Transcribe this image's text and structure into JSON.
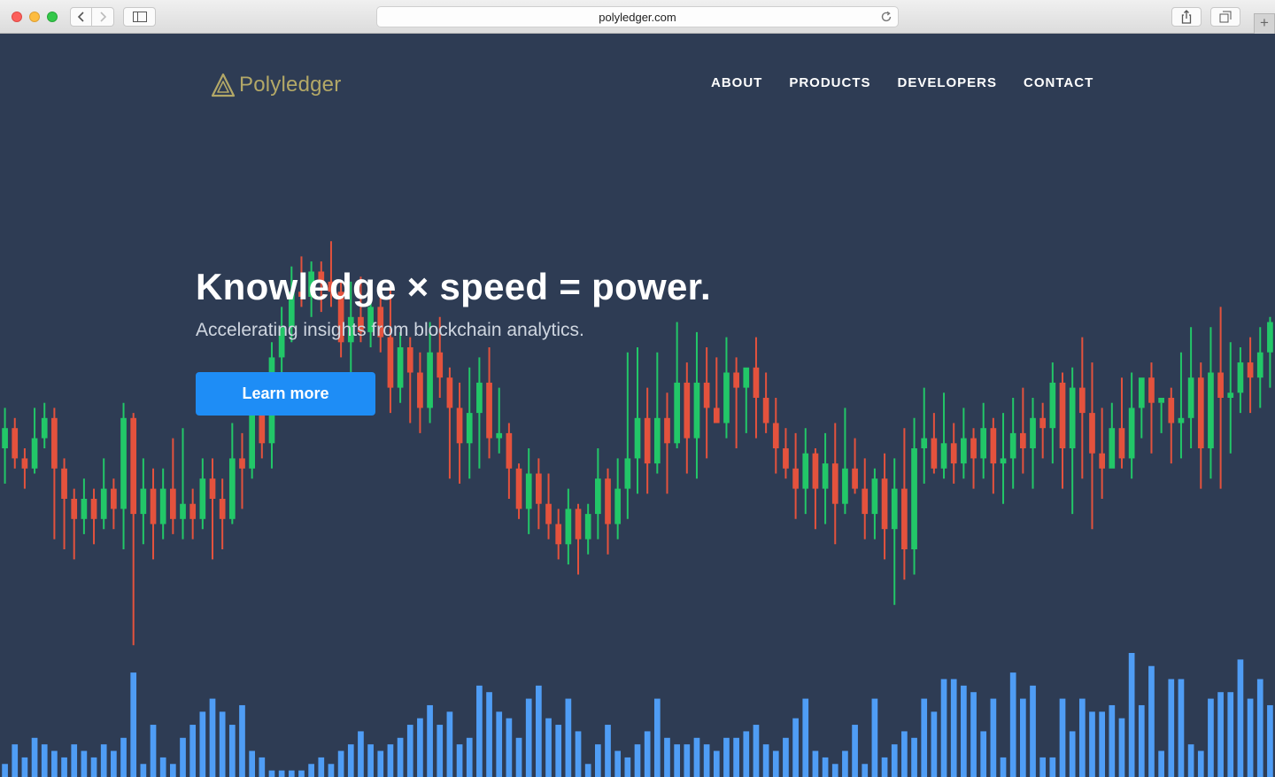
{
  "browser": {
    "url": "polyledger.com",
    "newtab_label": "+"
  },
  "brand": {
    "name": "Polyledger",
    "accent": "#b3a867"
  },
  "nav": [
    {
      "label": "ABOUT"
    },
    {
      "label": "PRODUCTS"
    },
    {
      "label": "DEVELOPERS"
    },
    {
      "label": "CONTACT"
    }
  ],
  "hero": {
    "title": "Knowledge × speed = power.",
    "subtitle": "Accelerating insights from blockchain analytics.",
    "cta_label": "Learn more",
    "cta_color": "#1e8df6"
  },
  "colors": {
    "background": "#2e3c54",
    "up": "#22c768",
    "down": "#e4523d",
    "volume": "#4f9df5"
  },
  "chart_data": {
    "type": "candlestick",
    "title": "",
    "xlabel": "",
    "ylabel": "",
    "ylim": [
      0,
      100
    ],
    "candles": [
      [
        60,
        64,
        53,
        68
      ],
      [
        64,
        58,
        56,
        66
      ],
      [
        58,
        56,
        52,
        60
      ],
      [
        56,
        62,
        55,
        68
      ],
      [
        62,
        66,
        60,
        69
      ],
      [
        66,
        56,
        42,
        68
      ],
      [
        56,
        50,
        40,
        58
      ],
      [
        50,
        46,
        38,
        52
      ],
      [
        46,
        50,
        43,
        54
      ],
      [
        50,
        46,
        41,
        52
      ],
      [
        46,
        52,
        44,
        58
      ],
      [
        52,
        48,
        44,
        54
      ],
      [
        48,
        66,
        40,
        69
      ],
      [
        66,
        47,
        21,
        67
      ],
      [
        47,
        52,
        41,
        58
      ],
      [
        52,
        45,
        38,
        56
      ],
      [
        45,
        52,
        42,
        56
      ],
      [
        52,
        46,
        43,
        62
      ],
      [
        46,
        49,
        42,
        64
      ],
      [
        49,
        46,
        42,
        52
      ],
      [
        46,
        54,
        44,
        58
      ],
      [
        54,
        50,
        38,
        58
      ],
      [
        50,
        46,
        40,
        54
      ],
      [
        46,
        58,
        45,
        65
      ],
      [
        58,
        56,
        48,
        63
      ],
      [
        56,
        68,
        54,
        72
      ],
      [
        68,
        61,
        58,
        67
      ],
      [
        61,
        78,
        56,
        81
      ],
      [
        78,
        84,
        69,
        88
      ],
      [
        84,
        91,
        81,
        96
      ],
      [
        91,
        90,
        88,
        98
      ],
      [
        90,
        95,
        86,
        97
      ],
      [
        95,
        93,
        87,
        97
      ],
      [
        93,
        91,
        88,
        101
      ],
      [
        91,
        81,
        78,
        93
      ],
      [
        81,
        86,
        74,
        93
      ],
      [
        86,
        83,
        81,
        94
      ],
      [
        83,
        88,
        80,
        92
      ],
      [
        88,
        82,
        79,
        90
      ],
      [
        82,
        72,
        67,
        92
      ],
      [
        72,
        80,
        69,
        83
      ],
      [
        80,
        75,
        65,
        82
      ],
      [
        75,
        68,
        63,
        79
      ],
      [
        68,
        79,
        65,
        85
      ],
      [
        79,
        74,
        70,
        86
      ],
      [
        74,
        68,
        54,
        76
      ],
      [
        68,
        61,
        53,
        73
      ],
      [
        61,
        67,
        54,
        76
      ],
      [
        67,
        73,
        56,
        78
      ],
      [
        73,
        62,
        58,
        80
      ],
      [
        62,
        63,
        59,
        72
      ],
      [
        63,
        56,
        50,
        65
      ],
      [
        56,
        48,
        46,
        57
      ],
      [
        48,
        55,
        43,
        60
      ],
      [
        55,
        49,
        44,
        58
      ],
      [
        49,
        45,
        42,
        55
      ],
      [
        45,
        41,
        38,
        48
      ],
      [
        41,
        48,
        37,
        52
      ],
      [
        48,
        42,
        35,
        49
      ],
      [
        42,
        47,
        39,
        49
      ],
      [
        47,
        54,
        42,
        60
      ],
      [
        54,
        45,
        39,
        56
      ],
      [
        45,
        52,
        42,
        58
      ],
      [
        52,
        58,
        46,
        79
      ],
      [
        58,
        66,
        51,
        80
      ],
      [
        66,
        57,
        51,
        72
      ],
      [
        57,
        66,
        55,
        79
      ],
      [
        66,
        61,
        51,
        71
      ],
      [
        61,
        73,
        60,
        85
      ],
      [
        73,
        62,
        55,
        77
      ],
      [
        62,
        73,
        54,
        83
      ],
      [
        73,
        68,
        58,
        80
      ],
      [
        68,
        65,
        65,
        78
      ],
      [
        65,
        75,
        62,
        82
      ],
      [
        75,
        72,
        60,
        78
      ],
      [
        72,
        76,
        63,
        74
      ],
      [
        76,
        70,
        62,
        82
      ],
      [
        70,
        65,
        63,
        75
      ],
      [
        65,
        60,
        55,
        70
      ],
      [
        60,
        56,
        54,
        64
      ],
      [
        56,
        52,
        46,
        63
      ],
      [
        52,
        59,
        47,
        64
      ],
      [
        59,
        52,
        44,
        60
      ],
      [
        52,
        57,
        45,
        63
      ],
      [
        57,
        49,
        41,
        65
      ],
      [
        49,
        56,
        47,
        68
      ],
      [
        56,
        52,
        51,
        62
      ],
      [
        52,
        47,
        42,
        58
      ],
      [
        47,
        54,
        42,
        56
      ],
      [
        54,
        44,
        38,
        59
      ],
      [
        44,
        52,
        29,
        58
      ],
      [
        52,
        40,
        34,
        64
      ],
      [
        40,
        60,
        35,
        66
      ],
      [
        60,
        62,
        53,
        72
      ],
      [
        62,
        56,
        55,
        67
      ],
      [
        56,
        61,
        54,
        71
      ],
      [
        61,
        57,
        53,
        65
      ],
      [
        57,
        62,
        54,
        68
      ],
      [
        62,
        58,
        52,
        64
      ],
      [
        58,
        64,
        54,
        69
      ],
      [
        64,
        57,
        51,
        66
      ],
      [
        57,
        58,
        49,
        67
      ],
      [
        58,
        63,
        52,
        70
      ],
      [
        63,
        60,
        55,
        72
      ],
      [
        60,
        66,
        52,
        70
      ],
      [
        66,
        64,
        58,
        69
      ],
      [
        64,
        73,
        57,
        77
      ],
      [
        73,
        60,
        52,
        75
      ],
      [
        60,
        72,
        47,
        76
      ],
      [
        72,
        67,
        54,
        82
      ],
      [
        67,
        59,
        44,
        77
      ],
      [
        59,
        56,
        50,
        68
      ],
      [
        56,
        64,
        58,
        69
      ],
      [
        64,
        58,
        56,
        74
      ],
      [
        58,
        68,
        54,
        75
      ],
      [
        68,
        74,
        62,
        72
      ],
      [
        74,
        69,
        59,
        77
      ],
      [
        69,
        70,
        63,
        69
      ],
      [
        70,
        65,
        57,
        72
      ],
      [
        65,
        66,
        58,
        79
      ],
      [
        66,
        74,
        60,
        84
      ],
      [
        74,
        60,
        52,
        77
      ],
      [
        60,
        75,
        54,
        84
      ],
      [
        75,
        70,
        52,
        88
      ],
      [
        70,
        71,
        59,
        81
      ],
      [
        71,
        77,
        67,
        80
      ],
      [
        77,
        74,
        67,
        82
      ],
      [
        74,
        79,
        68,
        84
      ],
      [
        79,
        85,
        72,
        86
      ]
    ],
    "volume": [
      2,
      5,
      3,
      6,
      5,
      4,
      3,
      5,
      4,
      3,
      5,
      4,
      6,
      16,
      2,
      8,
      3,
      2,
      6,
      8,
      10,
      12,
      10,
      8,
      11,
      4,
      3,
      1,
      1,
      1,
      1,
      2,
      3,
      2,
      4,
      5,
      7,
      5,
      4,
      5,
      6,
      8,
      9,
      11,
      8,
      10,
      5,
      6,
      14,
      13,
      10,
      9,
      6,
      12,
      14,
      9,
      8,
      12,
      7,
      2,
      5,
      8,
      4,
      3,
      5,
      7,
      12,
      6,
      5,
      5,
      6,
      5,
      4,
      6,
      6,
      7,
      8,
      5,
      4,
      6,
      9,
      12,
      4,
      3,
      2,
      4,
      8,
      2,
      12,
      3,
      5,
      7,
      6,
      12,
      10,
      15,
      15,
      14,
      13,
      7,
      12,
      3,
      16,
      12,
      14,
      3,
      3,
      12,
      7,
      12,
      10,
      10,
      11,
      9,
      19,
      11,
      17,
      4,
      15,
      15,
      5,
      4,
      12,
      13,
      13,
      18,
      12,
      15,
      11,
      18
    ]
  }
}
